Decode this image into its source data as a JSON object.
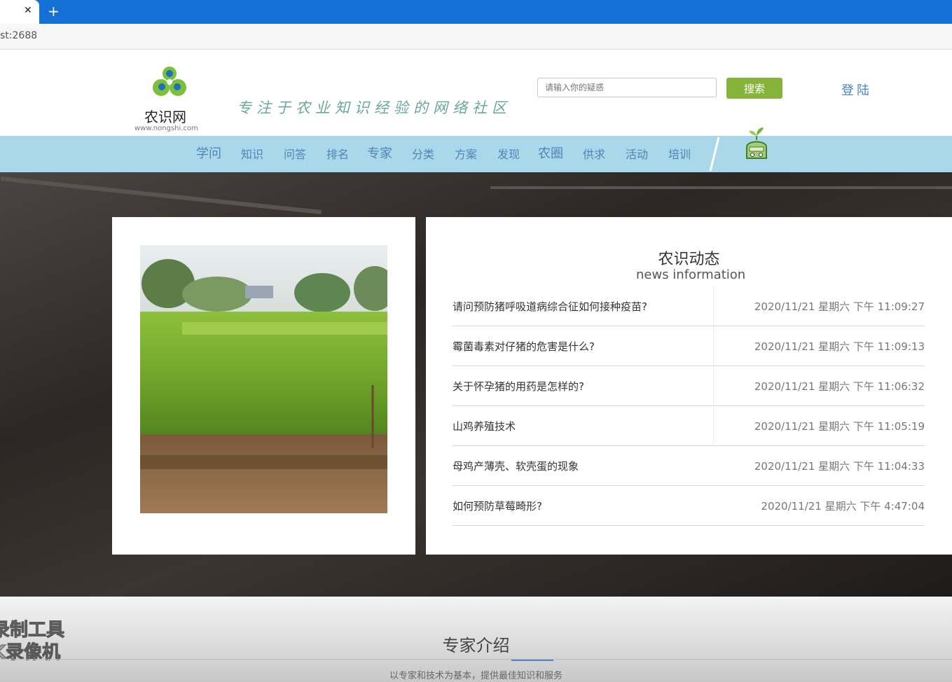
{
  "browser": {
    "address": "st:2688"
  },
  "header": {
    "logo_name": "农识网",
    "logo_url": "www.nongshi.com",
    "slogan": "专注于农业知识经验的网络社区",
    "search_placeholder": "请输入你的疑惑",
    "search_button": "搜索",
    "login": "登陆",
    "accent_color": "#86b33a"
  },
  "nav": {
    "items": [
      "学问",
      "知识",
      "问答",
      "排名",
      "专家",
      "分类",
      "方案",
      "发现",
      "农圈",
      "供求",
      "活动",
      "培训"
    ],
    "background": "#a9d8eb"
  },
  "news": {
    "title": "农识动态",
    "subtitle": "news information",
    "items": [
      {
        "title": "请问预防猪呼吸道病综合征如何接种疫苗?",
        "date": "2020/11/21 星期六 下午 11:09:27"
      },
      {
        "title": "霉菌毒素对仔猪的危害是什么?",
        "date": "2020/11/21 星期六 下午 11:09:13"
      },
      {
        "title": "关于怀孕猪的用药是怎样的?",
        "date": "2020/11/21 星期六 下午 11:06:32"
      },
      {
        "title": "山鸡养殖技术",
        "date": "2020/11/21 星期六 下午 11:05:19"
      },
      {
        "title": "母鸡产薄壳、软壳蛋的现象",
        "date": "2020/11/21 星期六 下午 11:04:33"
      },
      {
        "title": "如何预防草莓畸形?",
        "date": "2020/11/21 星期六 下午 4:47:04"
      }
    ]
  },
  "experts": {
    "title": "专家介绍",
    "subtitle": "以专家和技术为基本，提供最佳知识和服务"
  },
  "watermark": {
    "line1": "录制工具",
    "line2": "K录像机"
  }
}
